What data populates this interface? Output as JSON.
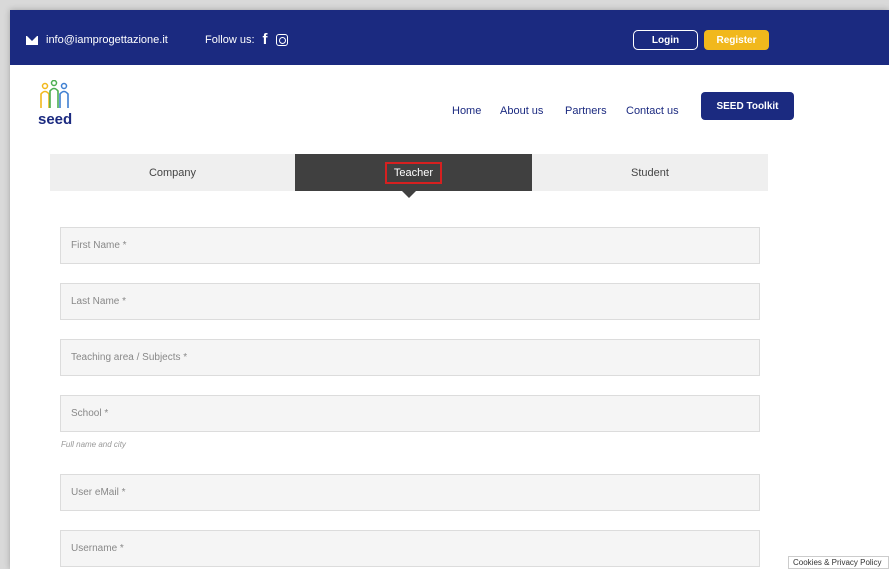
{
  "topbar": {
    "email": "info@iamprogettazione.it",
    "follow_label": "Follow us:",
    "login_label": "Login",
    "register_label": "Register"
  },
  "logo": {
    "text": "seed"
  },
  "nav": {
    "items": [
      "Home",
      "About us",
      "Partners",
      "Contact us"
    ],
    "toolkit_label": "SEED Toolkit"
  },
  "tabs": {
    "company": "Company",
    "teacher": "Teacher",
    "student": "Student",
    "active": "Teacher"
  },
  "form": {
    "first_name": "First Name *",
    "last_name": "Last Name *",
    "teaching_area": "Teaching area / Subjects *",
    "school": "School *",
    "school_hint": "Full name and city",
    "email": "User eMail *",
    "username": "Username *"
  },
  "cookie": {
    "label": "Cookies & Privacy Policy"
  },
  "colors": {
    "brand": "#1b2a80",
    "accent": "#f1b81c",
    "tab_active": "#404040",
    "highlight": "#d62020"
  }
}
